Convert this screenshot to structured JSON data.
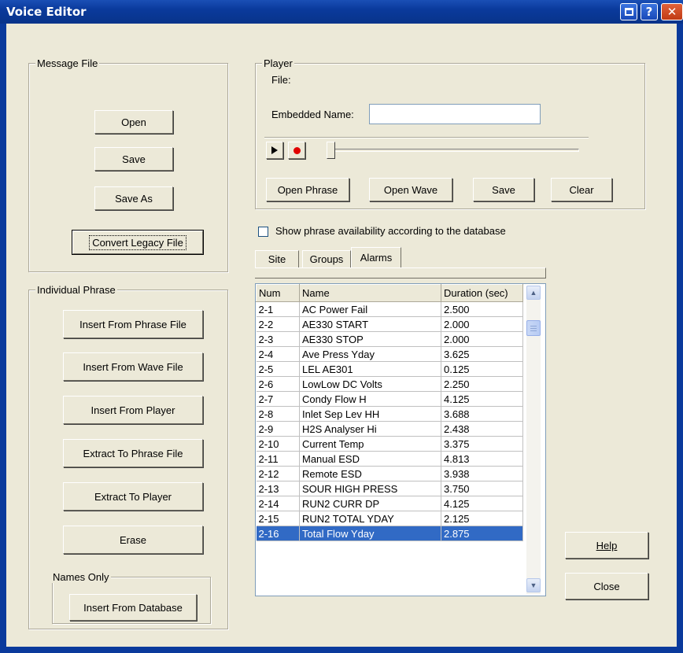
{
  "window": {
    "title": "Voice Editor",
    "help_glyph": "?",
    "close_glyph": "✕"
  },
  "message_file": {
    "legend": "Message File",
    "open": "Open",
    "save": "Save",
    "save_as": "Save As",
    "convert": "Convert Legacy File"
  },
  "individual_phrase": {
    "legend": "Individual Phrase",
    "insert_phrase_file": "Insert From Phrase File",
    "insert_wave_file": "Insert From Wave File",
    "insert_player": "Insert From Player",
    "extract_phrase_file": "Extract To Phrase File",
    "extract_player": "Extract To Player",
    "erase": "Erase",
    "names_only_legend": "Names Only",
    "insert_database": "Insert From Database"
  },
  "player": {
    "legend": "Player",
    "file_label": "File:",
    "embedded_label": "Embedded Name:",
    "embedded_value": "",
    "slider_position": 0,
    "open_phrase": "Open Phrase",
    "open_wave": "Open Wave",
    "save": "Save",
    "clear": "Clear"
  },
  "show_availability": {
    "label": "Show phrase availability according to the database",
    "checked": false
  },
  "tabs": [
    {
      "label": "Site",
      "active": false
    },
    {
      "label": "Groups",
      "active": false
    },
    {
      "label": "Alarms",
      "active": true
    }
  ],
  "table": {
    "columns": [
      "Num",
      "Name",
      "Duration (sec)"
    ],
    "rows": [
      [
        "2-1",
        "AC Power Fail",
        "2.500"
      ],
      [
        "2-2",
        "AE330 START",
        "2.000"
      ],
      [
        "2-3",
        "AE330 STOP",
        "2.000"
      ],
      [
        "2-4",
        "Ave Press Yday",
        "3.625"
      ],
      [
        "2-5",
        "LEL AE301",
        "0.125"
      ],
      [
        "2-6",
        "LowLow DC Volts",
        "2.250"
      ],
      [
        "2-7",
        "Condy Flow H",
        "4.125"
      ],
      [
        "2-8",
        "Inlet Sep Lev HH",
        "3.688"
      ],
      [
        "2-9",
        "H2S Analyser Hi",
        "2.438"
      ],
      [
        "2-10",
        "Current Temp",
        "3.375"
      ],
      [
        "2-11",
        "Manual ESD",
        "4.813"
      ],
      [
        "2-12",
        "Remote ESD",
        "3.938"
      ],
      [
        "2-13",
        "SOUR HIGH PRESS",
        "3.750"
      ],
      [
        "2-14",
        "RUN2 CURR DP",
        "4.125"
      ],
      [
        "2-15",
        "RUN2 TOTAL YDAY",
        "2.125"
      ],
      [
        "2-16",
        "Total Flow Yday",
        "2.875"
      ]
    ],
    "selected_index": 15
  },
  "dialog_buttons": {
    "help": "Help",
    "close": "Close"
  },
  "colors": {
    "titlebar": "#0a3a9c",
    "selection": "#316ac5",
    "record": "#e00000"
  }
}
